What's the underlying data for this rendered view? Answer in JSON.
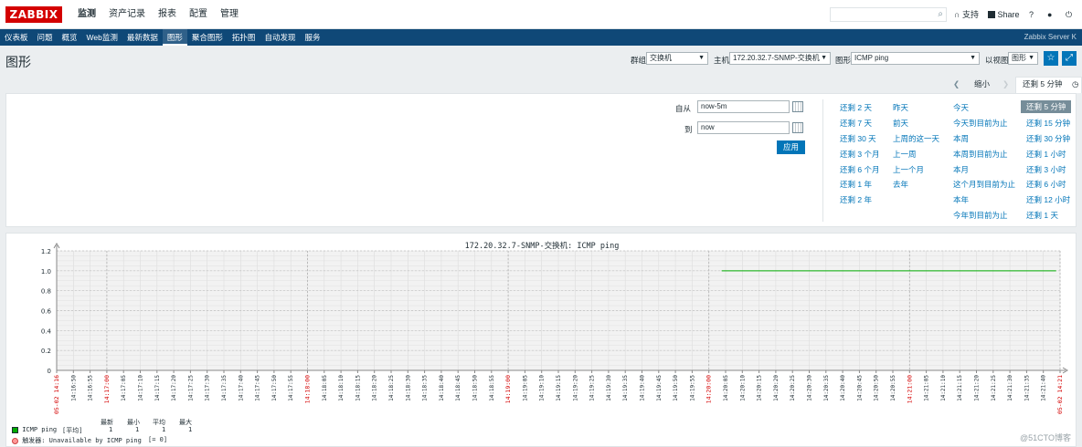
{
  "header": {
    "logo": "ZABBIX",
    "nav": [
      "监测",
      "资产记录",
      "报表",
      "配置",
      "管理"
    ],
    "support": "支持",
    "share": "Share",
    "help": "?",
    "user_icon": "user-icon",
    "logout_icon": "power-icon"
  },
  "subnav": {
    "items": [
      "仪表板",
      "问题",
      "概览",
      "Web监测",
      "最新数据",
      "图形",
      "聚合图形",
      "拓扑图",
      "自动发现",
      "服务"
    ],
    "active": "图形",
    "server": "Zabbix Server K"
  },
  "page": {
    "title": "图形",
    "group_label": "群组",
    "group_value": "交换机",
    "host_label": "主机",
    "host_value": "172.20.32.7-SNMP-交换机",
    "graph_label": "图形",
    "graph_value": "ICMP ping",
    "view_label": "以视图",
    "view_value": "图形"
  },
  "timetabs": {
    "zoom_out": "缩小",
    "active": "还剩 5 分钟"
  },
  "filter": {
    "from_label": "自从",
    "from_value": "now-5m",
    "to_label": "到",
    "to_value": "now",
    "apply": "应用",
    "col1": [
      "还剩 2 天",
      "还剩 7 天",
      "还剩 30 天",
      "还剩 3 个月",
      "还剩 6 个月",
      "还剩 1 年",
      "还剩 2 年"
    ],
    "col2": [
      "昨天",
      "前天",
      "上周的这一天",
      "上一周",
      "上一个月",
      "去年"
    ],
    "col3": [
      "今天",
      "今天到目前为止",
      "本周",
      "本周到目前为止",
      "本月",
      "这个月到目前为止",
      "本年",
      "今年到目前为止"
    ],
    "col4": [
      "还剩 5 分钟",
      "还剩 15 分钟",
      "还剩 30 分钟",
      "还剩 1 小时",
      "还剩 3 小时",
      "还剩 6 小时",
      "还剩 12 小时",
      "还剩 1 天"
    ]
  },
  "graph": {
    "title": "172.20.32.7-SNMP-交换机: ICMP ping",
    "legend_headers": [
      "最新",
      "最小",
      "平均",
      "最大"
    ],
    "legend_item": "ICMP ping",
    "legend_func": "[平均]",
    "legend_values": [
      "1",
      "1",
      "1",
      "1"
    ],
    "trigger": "触发器: Unavailable by ICMP ping",
    "trigger_cond": "[= 0]",
    "line_color": "#00aa00"
  },
  "chart_data": {
    "type": "line",
    "title": "172.20.32.7-SNMP-交换机: ICMP ping",
    "y_ticks": [
      "1.2",
      "1.0",
      "0.8",
      "0.6",
      "0.4",
      "0.2",
      "0"
    ],
    "ylim": [
      0,
      1.2
    ],
    "x_ticks": [
      "05-02 14:16",
      "14:16:50",
      "14:16:55",
      "14:17:00",
      "14:17:05",
      "14:17:10",
      "14:17:15",
      "14:17:20",
      "14:17:25",
      "14:17:30",
      "14:17:35",
      "14:17:40",
      "14:17:45",
      "14:17:50",
      "14:17:55",
      "14:18:00",
      "14:18:05",
      "14:18:10",
      "14:18:15",
      "14:18:20",
      "14:18:25",
      "14:18:30",
      "14:18:35",
      "14:18:40",
      "14:18:45",
      "14:18:50",
      "14:18:55",
      "14:19:00",
      "14:19:05",
      "14:19:10",
      "14:19:15",
      "14:19:20",
      "14:19:25",
      "14:19:30",
      "14:19:35",
      "14:19:40",
      "14:19:45",
      "14:19:50",
      "14:19:55",
      "14:20:00",
      "14:20:05",
      "14:20:10",
      "14:20:15",
      "14:20:20",
      "14:20:25",
      "14:20:30",
      "14:20:35",
      "14:20:40",
      "14:20:45",
      "14:20:50",
      "14:20:55",
      "14:21:00",
      "14:21:05",
      "14:21:10",
      "14:21:15",
      "14:21:20",
      "14:21:25",
      "14:21:30",
      "14:21:35",
      "14:21:40",
      "05-02 14:21"
    ],
    "red_ticks": [
      0,
      3,
      15,
      27,
      39,
      51,
      60
    ],
    "series": [
      {
        "name": "ICMP ping",
        "x_start": "14:20:00",
        "x_end": "14:21:40",
        "value": 1
      }
    ],
    "grid": true
  },
  "watermark": "@51CTO博客"
}
